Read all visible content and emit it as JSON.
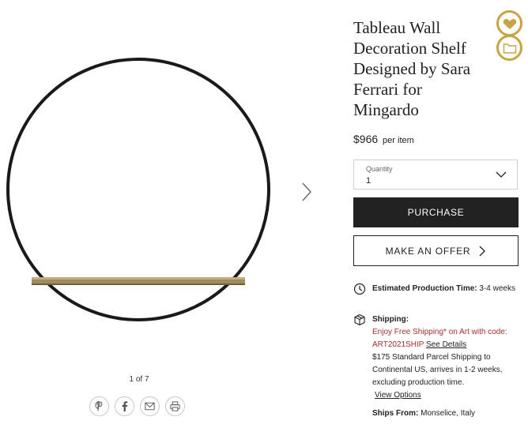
{
  "gallery": {
    "counter": "1 of 7",
    "share_icons": [
      "pinterest-icon",
      "facebook-icon",
      "email-icon",
      "print-icon"
    ]
  },
  "product": {
    "title": "Tableau Wall Decoration Shelf Designed by Sara Ferrari for Mingardo",
    "price": "$966",
    "price_unit": "per item"
  },
  "quantity": {
    "label": "Quantity",
    "value": "1"
  },
  "buttons": {
    "purchase": "PURCHASE",
    "offer": "MAKE AN OFFER"
  },
  "production": {
    "label": "Estimated Production Time:",
    "value": "3-4 weeks"
  },
  "shipping": {
    "label": "Shipping:",
    "promo": "Enjoy Free Shipping* on Art with code: ART2021SHIP",
    "see_details": "See Details",
    "standard": "$175 Standard Parcel Shipping to Continental US, arrives in 1-2 weeks, excluding production time.",
    "view_options": "View Options"
  },
  "ships_from": {
    "label": "Ships From:",
    "value": "Monselice, Italy"
  },
  "colors": {
    "accent_gold": "#c7a546",
    "button_dark": "#222222",
    "promo_red": "#a4322c"
  }
}
